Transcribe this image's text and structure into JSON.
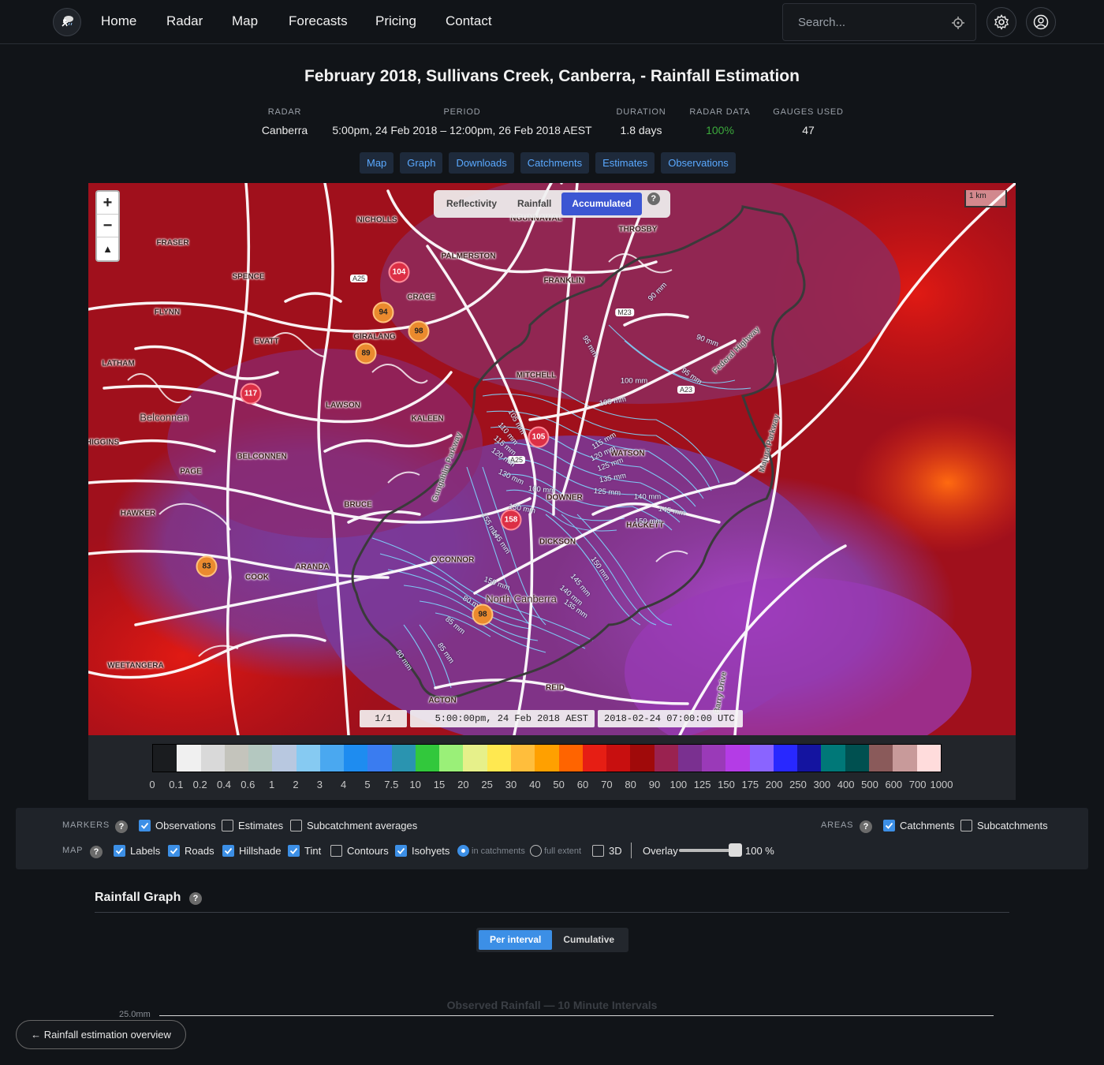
{
  "nav": {
    "items": [
      "Home",
      "Radar",
      "Map",
      "Forecasts",
      "Pricing",
      "Contact"
    ],
    "search_placeholder": "Search..."
  },
  "page_title": "February 2018, Sullivans Creek, Canberra, - Rainfall Estimation",
  "summary": [
    {
      "label": "RADAR",
      "value": "Canberra"
    },
    {
      "label": "PERIOD",
      "value": "5:00pm, 24 Feb 2018 – 12:00pm, 26 Feb 2018 AEST"
    },
    {
      "label": "DURATION",
      "value": "1.8 days"
    },
    {
      "label": "RADAR DATA",
      "value": "100%"
    },
    {
      "label": "GAUGES USED",
      "value": "47"
    }
  ],
  "tabs": [
    "Map",
    "Graph",
    "Downloads",
    "Catchments",
    "Estimates",
    "Observations"
  ],
  "map": {
    "layer_toggle": [
      "Reflectivity",
      "Rainfall",
      "Accumulated"
    ],
    "active_layer": "Accumulated",
    "help": "?",
    "scale": "1 km",
    "zoom_in": "+",
    "zoom_out": "−",
    "compass": "▲",
    "frame": "1/1",
    "time_local": "5:00:00pm, 24 Feb 2018 AEST",
    "time_utc": "2018-02-24 07:00:00 UTC",
    "markers": [
      {
        "value": "104",
        "color": "red"
      },
      {
        "value": "94",
        "color": "orange"
      },
      {
        "value": "98",
        "color": "orange"
      },
      {
        "value": "89",
        "color": "orange"
      },
      {
        "value": "117",
        "color": "red"
      },
      {
        "value": "105",
        "color": "red"
      },
      {
        "value": "158",
        "color": "red"
      },
      {
        "value": "83",
        "color": "orange"
      },
      {
        "value": "98",
        "color": "orange"
      }
    ],
    "suburbs": [
      "NICHOLLS",
      "NGUNNAWAL",
      "THROSBY",
      "FRASER",
      "PALMERSTON",
      "SPENCE",
      "FRANKLIN",
      "GIRALANG",
      "CRACE",
      "FLYNN",
      "EVATT",
      "GIRALANG",
      "LATHAM",
      "MITCHELL",
      "Belconnen",
      "LAWSON",
      "KALEEN",
      "HIGGINS",
      "BELCONNEN",
      "WATSON",
      "PAGE",
      "DOWNER",
      "BRUCE",
      "HAWKER",
      "HACKETT",
      "DICKSON",
      "O'CONNOR",
      "COOK",
      "ARANDA",
      "North Canberra",
      "WEETANGERA",
      "REID",
      "ACTON"
    ],
    "isohyets": [
      "80 mm",
      "85 mm",
      "90 mm",
      "90 mm",
      "95 mm",
      "95 mm",
      "100 mm",
      "105 mm",
      "105 mm",
      "110 mm",
      "115 mm",
      "115 mm",
      "120 mm",
      "125 mm",
      "130 mm",
      "135 mm",
      "140 mm",
      "145 mm",
      "150 mm",
      "150 mm",
      "145 mm",
      "140 mm",
      "135 mm",
      "155 mm",
      "145 mm",
      "150 mm",
      "130 mm",
      "85 mm",
      "80 mm",
      "100 mm",
      "120 mm",
      "125 mm"
    ],
    "road_labels": [
      "A25",
      "M23",
      "A23",
      "A25"
    ],
    "road_names": [
      "Federal Highway",
      "Majura Parkway",
      "Gungahlin Parkway",
      "Barry Drive"
    ]
  },
  "legend": {
    "colors": [
      "#1a1c1f",
      "#f0f0f0",
      "#d9d9d9",
      "#c4c4bc",
      "#b4c8c0",
      "#b8c8e0",
      "#86caf2",
      "#4aa8f0",
      "#1e8cf0",
      "#3a7cf0",
      "#2a94b0",
      "#32c83c",
      "#9af078",
      "#e6f08a",
      "#ffe850",
      "#ffbe3c",
      "#ffa000",
      "#ff6400",
      "#e61e14",
      "#c80f0f",
      "#a00a0a",
      "#9a2250",
      "#7a3090",
      "#9a3ab8",
      "#b43ce6",
      "#8a64ff",
      "#2828ff",
      "#1414a0",
      "#007878",
      "#005050",
      "#8a5a5a",
      "#c89a9a",
      "#ffdcdc"
    ],
    "ticks": [
      "0",
      "0.1",
      "0.2",
      "0.4",
      "0.6",
      "1",
      "2",
      "3",
      "4",
      "5",
      "7.5",
      "10",
      "15",
      "20",
      "25",
      "30",
      "40",
      "50",
      "60",
      "70",
      "80",
      "90",
      "100",
      "125",
      "150",
      "175",
      "200",
      "250",
      "300",
      "400",
      "500",
      "600",
      "700",
      "1000"
    ]
  },
  "options": {
    "markers_label": "MARKERS",
    "areas_label": "AREAS",
    "map_label": "MAP",
    "markers": [
      {
        "label": "Observations",
        "checked": true
      },
      {
        "label": "Estimates",
        "checked": false
      },
      {
        "label": "Subcatchment averages",
        "checked": false
      }
    ],
    "areas": [
      {
        "label": "Catchments",
        "checked": true
      },
      {
        "label": "Subcatchments",
        "checked": false
      }
    ],
    "map": [
      {
        "label": "Labels",
        "checked": true
      },
      {
        "label": "Roads",
        "checked": true
      },
      {
        "label": "Hillshade",
        "checked": true
      },
      {
        "label": "Tint",
        "checked": true
      },
      {
        "label": "Contours",
        "checked": false
      },
      {
        "label": "Isohyets",
        "checked": true
      }
    ],
    "isohyet_extent": [
      {
        "label": "in catchments",
        "selected": true
      },
      {
        "label": "full extent",
        "selected": false
      }
    ],
    "three_d": {
      "label": "3D",
      "checked": false
    },
    "overlay_label": "Overlay",
    "overlay_value": "100 %",
    "overlay_level": 100
  },
  "graph": {
    "title": "Rainfall Graph",
    "modes": [
      "Per interval",
      "Cumulative"
    ],
    "active_mode": "Per interval",
    "chart_title": "Observed Rainfall — 10 Minute Intervals",
    "y_tick": "25.0mm"
  },
  "back_button": "← Rainfall estimation overview"
}
